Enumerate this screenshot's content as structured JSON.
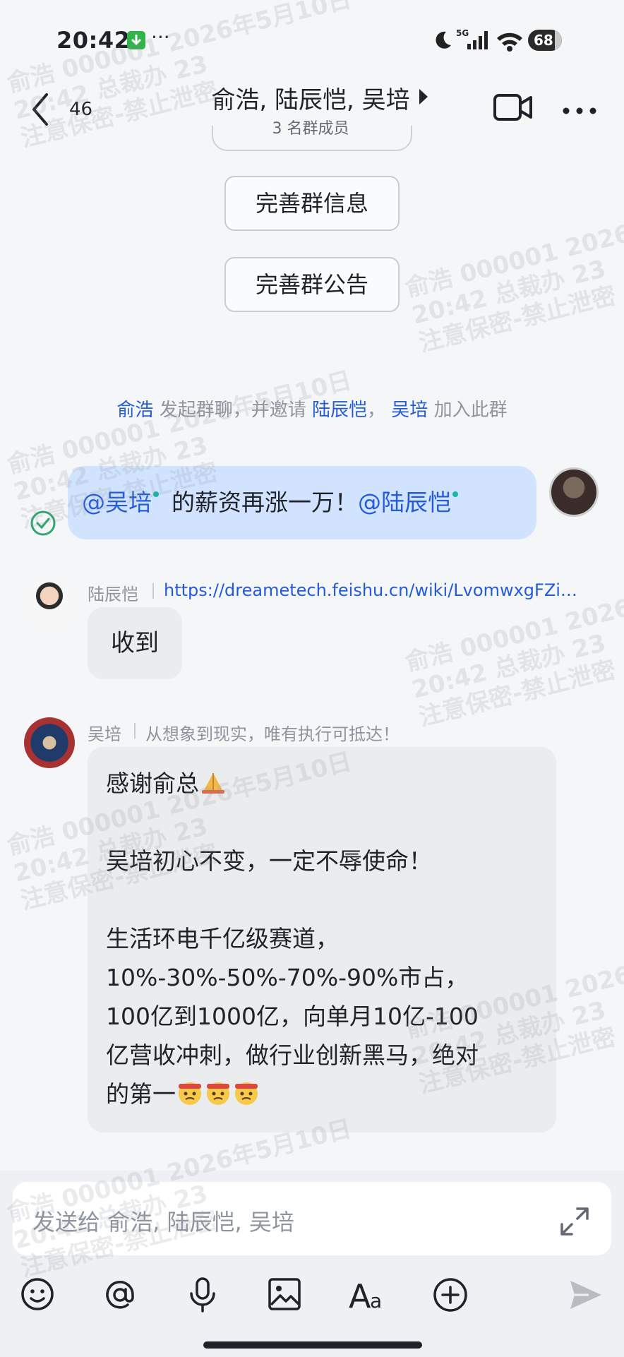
{
  "status_bar": {
    "time": "20:42",
    "more_dots": "···",
    "network_type": "5G",
    "battery_level": "68"
  },
  "header": {
    "unread_count": "46",
    "title": "俞浩, 陆辰恺, 吴培",
    "subtitle": "3 名群成员"
  },
  "actions": {
    "complete_group_info": "完善群信息",
    "complete_group_notice": "完善群公告"
  },
  "system_message": {
    "initiator": "俞浩",
    "text1": "发起群聊，并邀请",
    "invitee1": "陆辰恺",
    "separator": "，",
    "invitee2": "吴培",
    "text2": "加入此群"
  },
  "messages": [
    {
      "mention1": "@吴培",
      "body": "的薪资再涨一万！",
      "mention2": "@陆辰恺"
    },
    {
      "sender": "陆辰恺",
      "link": "https://dreametech.feishu.cn/wiki/LvomwxgFZi…",
      "text": "收到"
    },
    {
      "sender": "吴培",
      "status_text": "从想象到现实，唯有执行可抵达！",
      "lines": [
        "感谢俞总",
        "吴培初心不变，一定不辱使命！",
        "生活环电千亿级赛道，",
        "10%-30%-50%-70%-90%市占，",
        "100亿到1000亿，向单月10亿-100",
        "亿营收冲刺，做行业创新黑马，绝对",
        "的第一"
      ]
    }
  ],
  "input": {
    "placeholder": "发送给 俞浩, 陆辰恺, 吴培"
  },
  "watermark": {
    "line1": "俞浩 000001 2026年5月10日",
    "line2": "20:42 总裁办 23",
    "line3": "注意保密-禁止泄密"
  },
  "colors": {
    "accent": "#245bdb",
    "my_bubble": "#d1e3fe",
    "other_bubble": "#ebecee",
    "background": "#f5f6f8"
  }
}
